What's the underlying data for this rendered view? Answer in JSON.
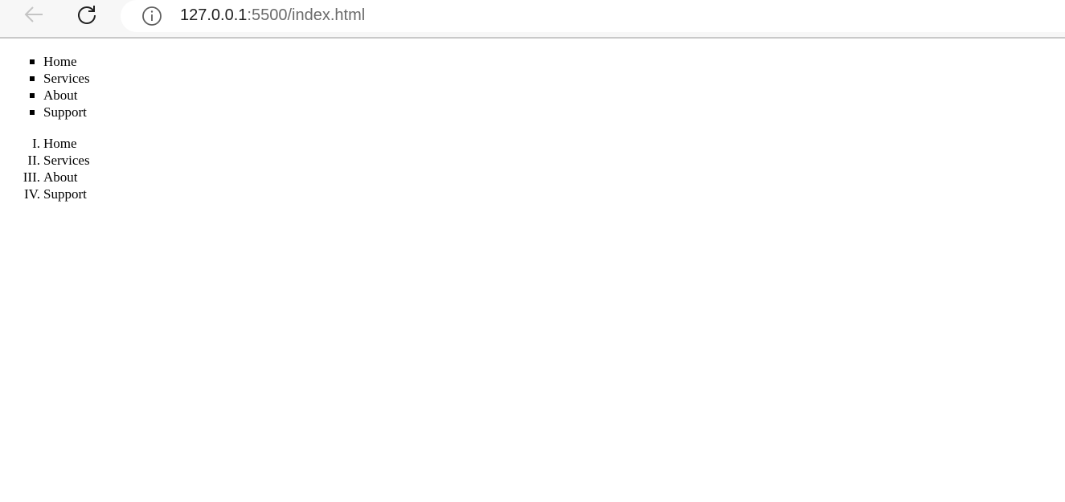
{
  "browser": {
    "url_host": "127.0.0.1",
    "url_rest": ":5500/index.html"
  },
  "unordered_list": {
    "items": [
      {
        "label": "Home"
      },
      {
        "label": "Services"
      },
      {
        "label": "About"
      },
      {
        "label": "Support"
      }
    ]
  },
  "ordered_list": {
    "items": [
      {
        "marker": "I.",
        "label": "Home"
      },
      {
        "marker": "II.",
        "label": "Services"
      },
      {
        "marker": "III.",
        "label": "About"
      },
      {
        "marker": "IV.",
        "label": "Support"
      }
    ]
  }
}
